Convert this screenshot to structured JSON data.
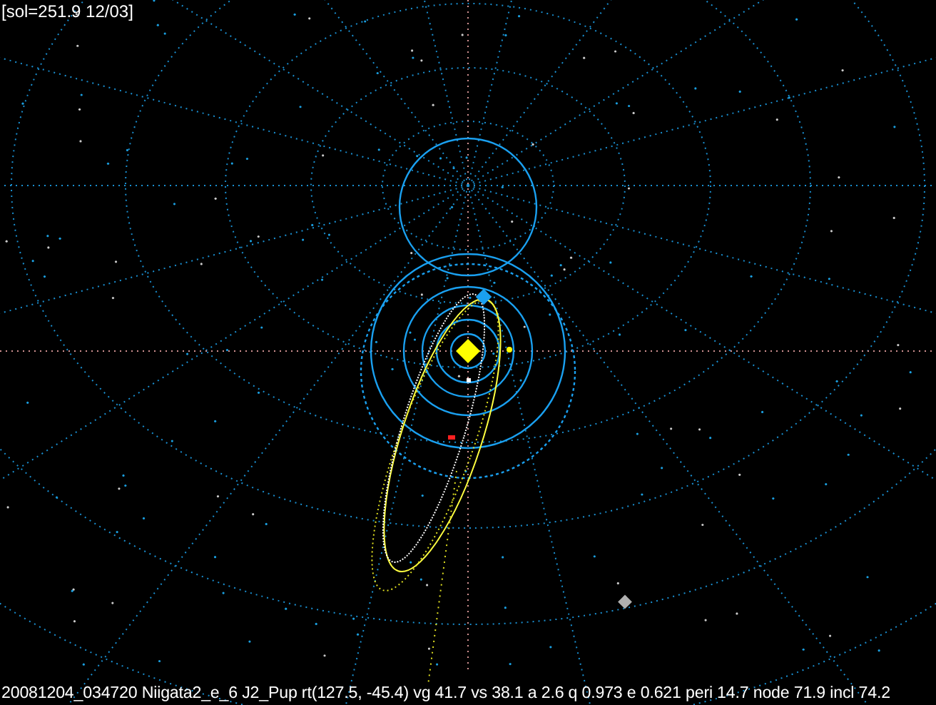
{
  "header": {
    "label": "[sol=251.9 12/03]"
  },
  "footer": {
    "info": "20081204_034720 Niigata2_e_6 J2_Pup rt(127.5, -45.4) vg 41.7 vs 38.1 a 2.6 q 0.973 e 0.621 peri 14.7 node 71.9 incl 74.2"
  }
}
